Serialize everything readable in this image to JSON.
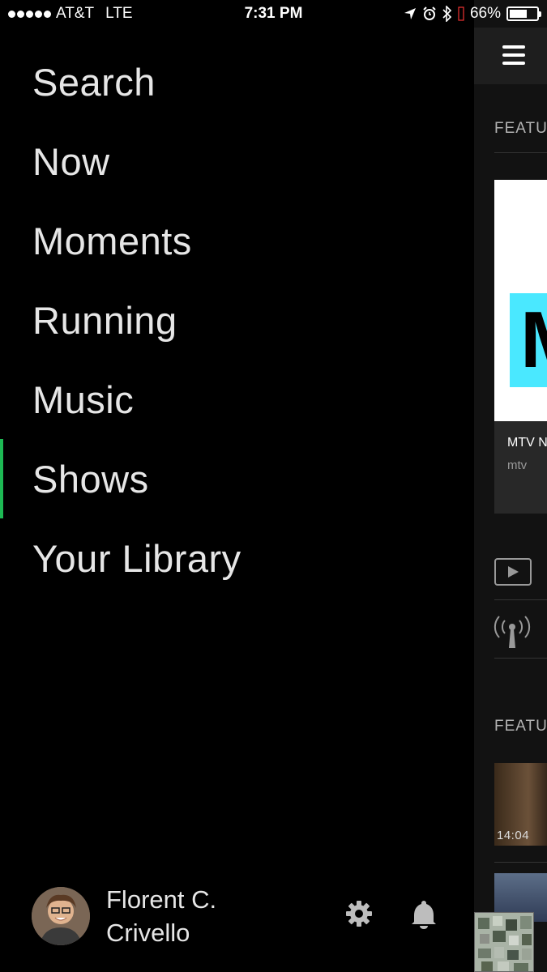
{
  "status_bar": {
    "carrier": "AT&T",
    "network": "LTE",
    "time": "7:31 PM",
    "battery_percent_text": "66%",
    "battery_level": 0.66
  },
  "menu": {
    "items": [
      {
        "label": "Search",
        "active": false
      },
      {
        "label": "Now",
        "active": false
      },
      {
        "label": "Moments",
        "active": false
      },
      {
        "label": "Running",
        "active": false
      },
      {
        "label": "Music",
        "active": false
      },
      {
        "label": "Shows",
        "active": true
      },
      {
        "label": "Your Library",
        "active": false
      }
    ],
    "accent_color": "#1db954"
  },
  "user": {
    "name_line1": "Florent C.",
    "name_line2": "Crivello"
  },
  "footer_icons": [
    "gear-icon",
    "bell-icon"
  ],
  "main_panel": {
    "section1_label": "FEATU",
    "feature_card": {
      "title": "MTV N",
      "subtitle": "mtv",
      "art_letter": "M"
    },
    "section2_label": "FEATU",
    "episode_duration": "14:04",
    "icons": [
      "menu-icon",
      "video-icon",
      "radio-icon"
    ]
  }
}
